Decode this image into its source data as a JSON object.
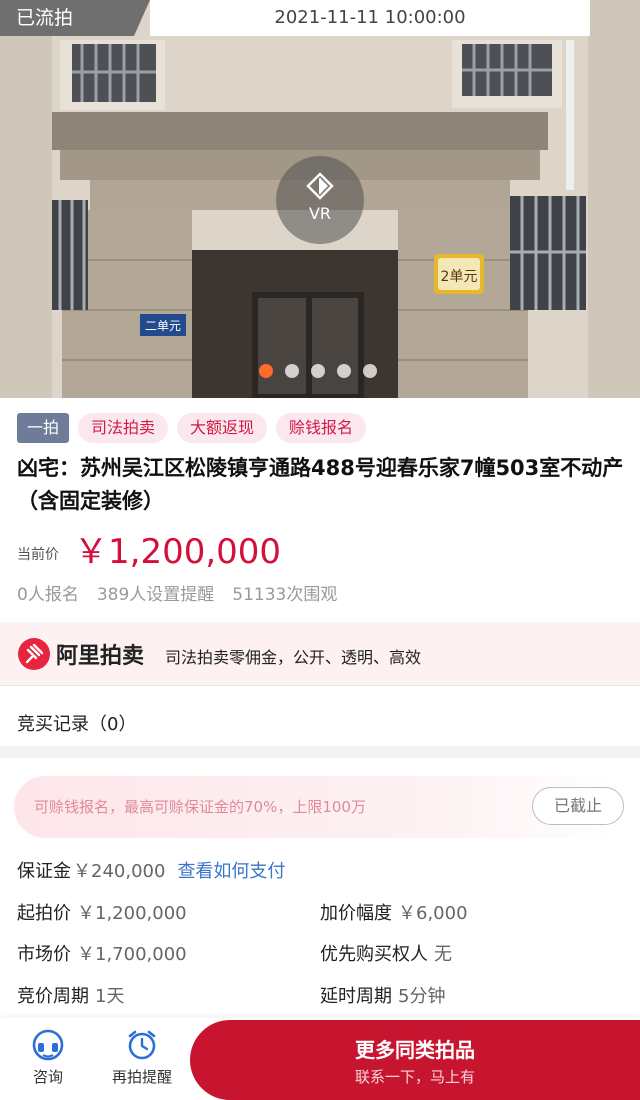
{
  "hero": {
    "status": "已流拍",
    "time": "2021-11-11 10:00:00",
    "vr_label": "VR",
    "slides_total": 5,
    "slide_active": 1,
    "photo_labels": {
      "unit_sign_left": "二单元",
      "unit_sign_right": "2单元"
    }
  },
  "tags": {
    "first": "一拍",
    "items": [
      "司法拍卖",
      "大额返现",
      "赊钱报名"
    ]
  },
  "title": "凶宅：苏州吴江区松陵镇亨通路488号迎春乐家7幢503室不动产（含固定装修）",
  "price": {
    "label": "当前价",
    "value": "￥1,200,000"
  },
  "stats": [
    "0人报名",
    "389人设置提醒",
    "51133次围观"
  ],
  "ali": {
    "brand": "阿里拍卖",
    "slogan": "司法拍卖零佣金，公开、透明、高效"
  },
  "records": {
    "label": "竞买记录（0）"
  },
  "promo": {
    "text": "可赊钱报名，最高可赊保证金的70%，上限100万",
    "button": "已截止"
  },
  "deposit": {
    "label": "保证金",
    "value": "￥240,000",
    "link": "查看如何支付"
  },
  "details": {
    "start_price": {
      "label": "起拍价",
      "value": "￥1,200,000"
    },
    "increment": {
      "label": "加价幅度",
      "value": "￥6,000"
    },
    "market_price": {
      "label": "市场价",
      "value": "￥1,700,000"
    },
    "priority": {
      "label": "优先购买权人",
      "value": "无"
    },
    "cycle": {
      "label": "竞价周期",
      "value": "1天"
    },
    "delay": {
      "label": "延时周期",
      "value": "5分钟"
    }
  },
  "bottom": {
    "consult": "咨询",
    "remind": "再拍提醒",
    "cta_main": "更多同类拍品",
    "cta_sub": "联系一下，马上有"
  },
  "colors": {
    "accent": "#d4103a",
    "cta": "#c8152f",
    "tag_first": "#6f7c99",
    "link": "#3a76c9",
    "dot_active": "#ff6a2b"
  }
}
